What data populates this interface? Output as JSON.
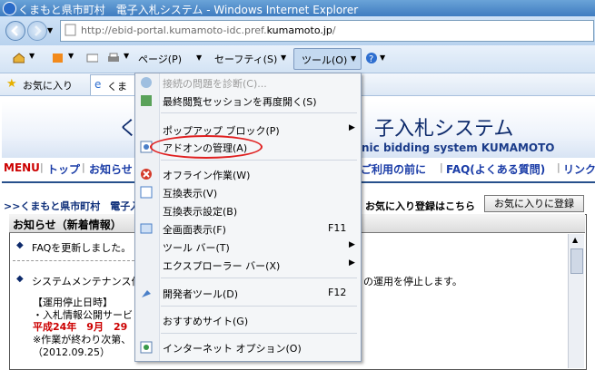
{
  "window": {
    "title": "くまもと県市町村　電子入札システム - Windows Internet Explorer"
  },
  "address": {
    "prefix": "http://ebid-portal.kumamoto-idc.pref.",
    "domain": "kumamoto.jp",
    "suffix": "/"
  },
  "commandbar": {
    "page": "ページ(P)",
    "safety": "セーフティ(S)",
    "tools": "ツール(O)"
  },
  "favorites": {
    "label": "お気に入り",
    "tab_text": "くま"
  },
  "site": {
    "banner_title": "子入札システム",
    "banner_first_char": "く",
    "banner_sub": "nic bidding system KUMAMOTO",
    "menu_left": [
      "MENU",
      "トップ",
      "お知らせ"
    ],
    "menu_right": [
      "ご利用の前に",
      "FAQ(よくある質問)",
      "リンク"
    ],
    "breadcrumb": ">>くまもと県市町村　電子入",
    "fav_note": "お気に入り登録はこちら",
    "fav_button": "お気に入りに登録",
    "news_title": "お知らせ（新着情報）",
    "news_items": [
      "FAQを更新しました。",
      "システムメンテナンス作",
      "の運用を停止します。"
    ],
    "news_detail": [
      "【運用停止日時】",
      "・入札情報公開サービ",
      "平成24年　9月　29",
      "※作業が終わり次第、",
      "（2012.09.25）"
    ]
  },
  "tools_menu": {
    "items": [
      {
        "label": "接続の問題を診断(C)...",
        "disabled": true,
        "icon": "diagnose-icon"
      },
      {
        "label": "最終閲覧セッションを再度開く(S)",
        "icon": "reopen-session-icon"
      },
      {
        "label": "ポップアップ ブロック(P)",
        "submenu": true
      },
      {
        "label": "アドオンの管理(A)",
        "icon": "addon-icon"
      },
      {
        "label": "オフライン作業(W)",
        "icon": "offline-icon"
      },
      {
        "label": "互換表示(V)",
        "icon": "compat-view-icon"
      },
      {
        "label": "互換表示設定(B)"
      },
      {
        "label": "全画面表示(F)",
        "shortcut": "F11",
        "icon": "fullscreen-icon"
      },
      {
        "label": "ツール バー(T)",
        "submenu": true
      },
      {
        "label": "エクスプローラー バー(X)",
        "submenu": true
      },
      {
        "label": "開発者ツール(D)",
        "shortcut": "F12",
        "icon": "developer-tools-icon"
      },
      {
        "label": "おすすめサイト(G)"
      },
      {
        "label": "インターネット オプション(O)",
        "icon": "internet-options-icon"
      }
    ]
  }
}
